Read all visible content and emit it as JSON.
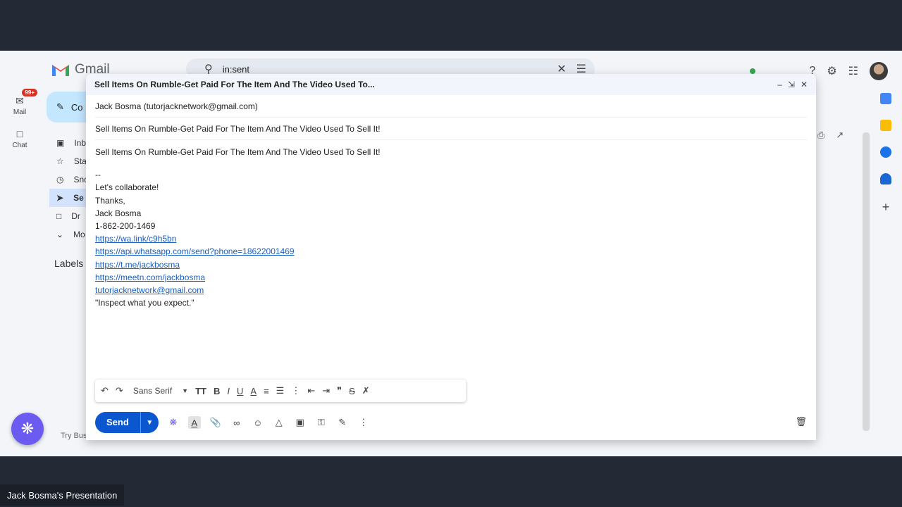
{
  "app": {
    "name": "Gmail"
  },
  "search": {
    "query": "in:sent"
  },
  "rail": [
    {
      "label": "Mail",
      "badge": "99+"
    },
    {
      "label": "Chat"
    }
  ],
  "compose_button": {
    "label": "Co"
  },
  "nav": [
    {
      "label": "Inb"
    },
    {
      "label": "Sta"
    },
    {
      "label": "Sno"
    },
    {
      "label": "Se",
      "active": true
    },
    {
      "label": "Dr"
    },
    {
      "label": "Mo"
    }
  ],
  "labels_heading": "Labels",
  "try_business": "Try Business plan",
  "compose": {
    "title": "Sell Items On Rumble-Get Paid For The Item And The Video Used To...",
    "to": "Jack Bosma (tutorjacknetwork@gmail.com)",
    "subject": "Sell Items On Rumble-Get Paid For The Item And The Video Used To Sell It!",
    "body_first": "Sell Items On Rumble-Get Paid For The Item And The Video Used To Sell It!",
    "sig_sep": "--",
    "sig_lines": [
      "Let's collaborate!",
      "Thanks,",
      "Jack Bosma",
      "1-862-200-1469"
    ],
    "links": [
      "https://wa.link/c9h5bn",
      "https://api.whatsapp.com/send?phone=18622001469",
      "https://t.me/jackbosma",
      "https://meetn.com/jackbosma",
      "tutorjacknetwork@gmail.com"
    ],
    "quote": "\"Inspect what you expect.\"",
    "font_name": "Sans Serif",
    "send_label": "Send"
  },
  "caption": "Jack Bosma's Presentation",
  "colors": {
    "send": "#0b57d0",
    "link": "#1a5fbf",
    "fab": "#6b5bf0"
  }
}
